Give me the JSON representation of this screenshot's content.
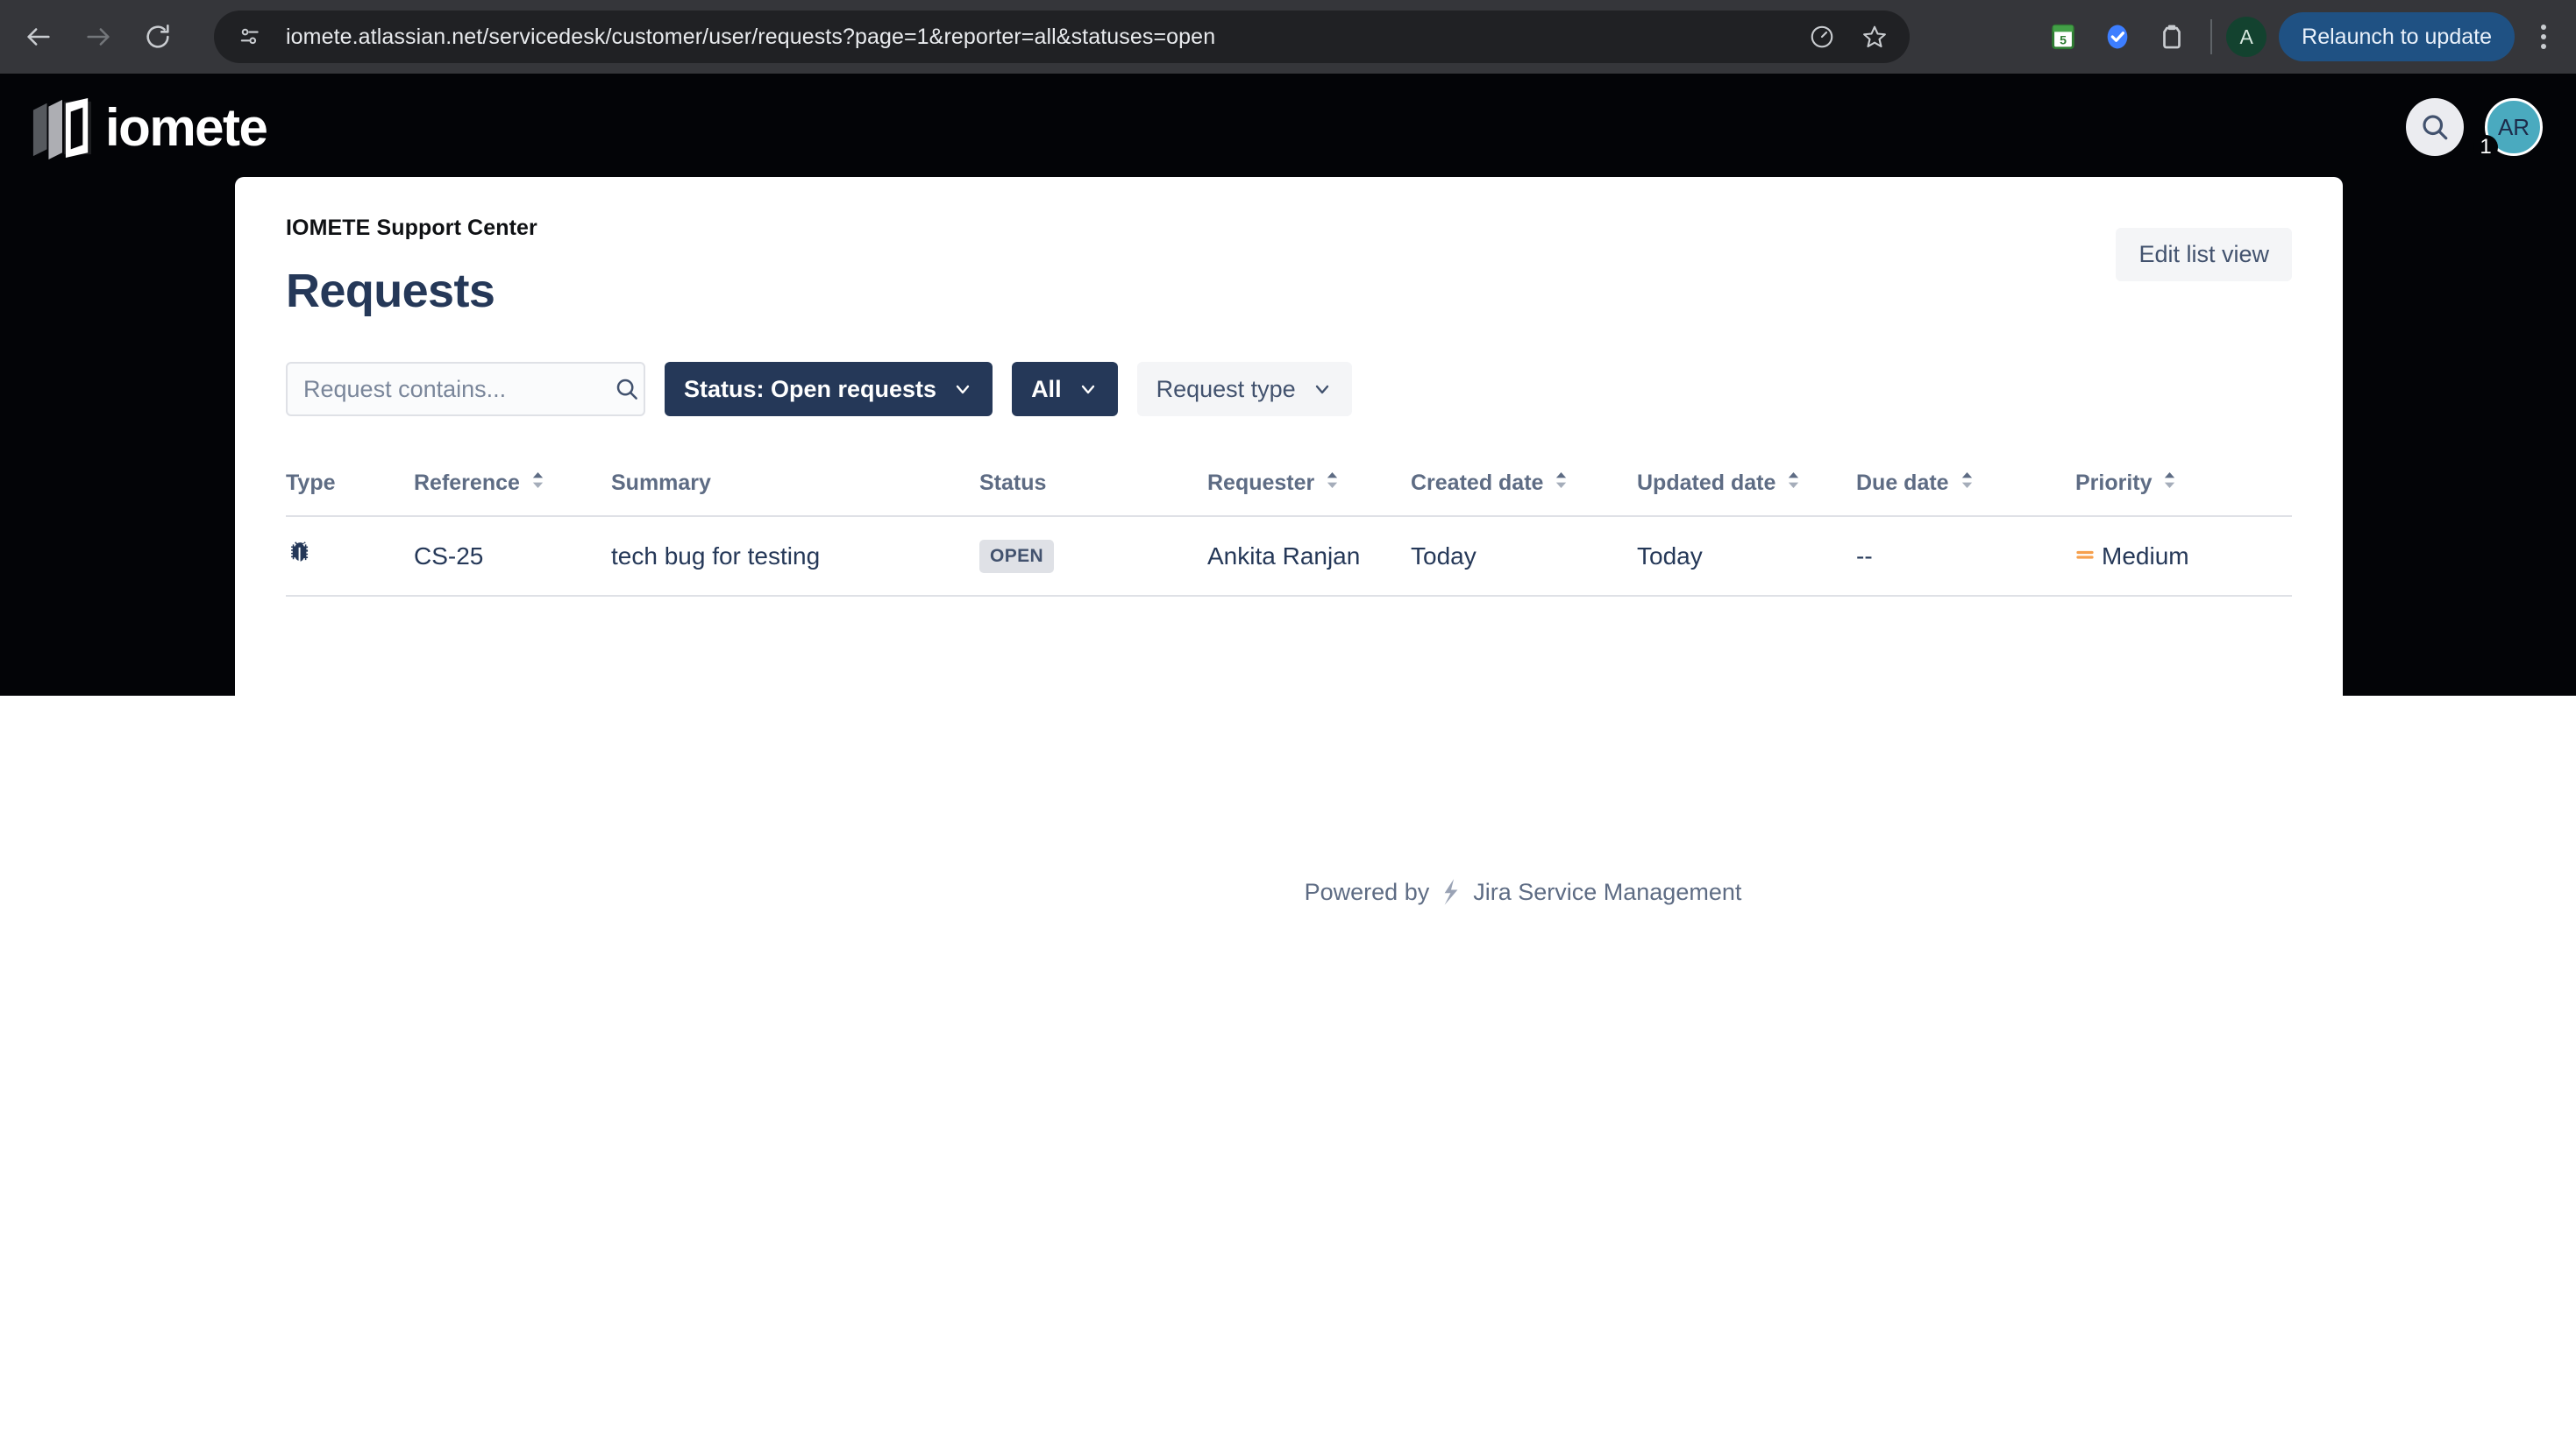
{
  "browser": {
    "back_label": "Back",
    "forward_label": "Forward",
    "reload_label": "Reload",
    "site_info_label": "View site information",
    "url": "iomete.atlassian.net/servicedesk/customer/user/requests?page=1&reporter=all&statuses=open",
    "performance_label": "Performance",
    "bookmark_label": "Bookmark this tab",
    "extensions": [
      "calendar-extension",
      "checkmark-extension",
      "clipboard-extension"
    ],
    "profile_initial": "A",
    "relaunch_label": "Relaunch to update",
    "menu_label": "Customize and control Chrome"
  },
  "hero": {
    "logo_text": "iomete",
    "search_label": "Search",
    "avatar_initials": "AR",
    "avatar_badge": "1"
  },
  "header": {
    "portal_name": "IOMETE Support Center",
    "page_title": "Requests",
    "edit_list_view": "Edit list view"
  },
  "filters": {
    "search_placeholder": "Request contains...",
    "search_value": "",
    "status_filter": "Status: Open requests",
    "scope_filter": "All",
    "request_type_filter": "Request type"
  },
  "table": {
    "columns": [
      {
        "label": "Type",
        "sortable": false
      },
      {
        "label": "Reference",
        "sortable": true
      },
      {
        "label": "Summary",
        "sortable": false
      },
      {
        "label": "Status",
        "sortable": false
      },
      {
        "label": "Requester",
        "sortable": true
      },
      {
        "label": "Created date",
        "sortable": true
      },
      {
        "label": "Updated date",
        "sortable": true
      },
      {
        "label": "Due date",
        "sortable": true
      },
      {
        "label": "Priority",
        "sortable": true
      }
    ],
    "rows": [
      {
        "type_icon": "bug-icon",
        "reference": "CS-25",
        "summary": "tech bug for testing",
        "status": "OPEN",
        "requester": "Ankita Ranjan",
        "created": "Today",
        "updated": "Today",
        "due": "--",
        "priority": "Medium",
        "priority_color": "#f6a04d"
      }
    ]
  },
  "footer": {
    "powered_by": "Powered by",
    "product": "Jira Service Management"
  },
  "colors": {
    "hero_bg": "#030407",
    "navy": "#253858",
    "muted": "#5e6c84",
    "badge_bg": "#dfe1e6",
    "accent_blue": "#1f5183",
    "avatar_teal": "#4aaabf"
  }
}
